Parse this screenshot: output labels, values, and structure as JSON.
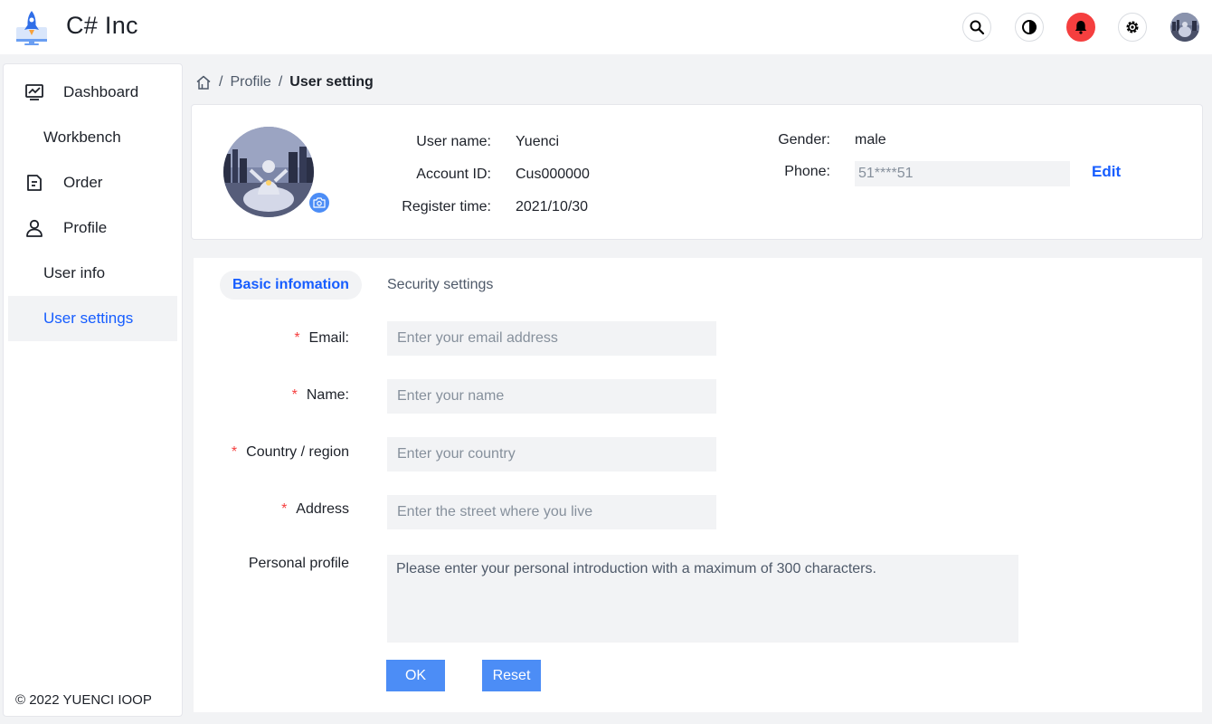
{
  "app": {
    "brand": "C# Inc"
  },
  "header": {
    "icons": [
      "search-icon",
      "theme-toggle-icon",
      "bell-icon",
      "gear-icon",
      "avatar"
    ],
    "bell_color": "#f53f3f"
  },
  "sidebar": {
    "items": [
      {
        "label": "Dashboard",
        "icon": "dashboard-icon"
      },
      {
        "label": "Workbench"
      },
      {
        "label": "Order",
        "icon": "order-icon"
      },
      {
        "label": "Profile",
        "icon": "user-icon"
      },
      {
        "label": "User info"
      },
      {
        "label": "User settings",
        "active": true
      }
    ],
    "copyright": "© 2022 YUENCI IOOP"
  },
  "breadcrumb": {
    "root": "Profile",
    "current": "User setting"
  },
  "profile": {
    "username_label": "User name:",
    "username": "Yuenci",
    "account_label": "Account ID:",
    "account_id": "Cus000000",
    "register_label": "Register time:",
    "register_time": "2021/10/30",
    "gender_label": "Gender:",
    "gender": "male",
    "phone_label": "Phone:",
    "phone": "51****51",
    "edit_label": "Edit"
  },
  "tabs": [
    {
      "label": "Basic infomation",
      "active": true
    },
    {
      "label": "Security settings",
      "active": false
    }
  ],
  "form": {
    "email": {
      "label": "Email:",
      "placeholder": "Enter your email address",
      "required": true
    },
    "name": {
      "label": "Name:",
      "placeholder": "Enter your name",
      "required": true
    },
    "country": {
      "label": "Country / region",
      "placeholder": "Enter your country",
      "required": true
    },
    "address": {
      "label": "Address",
      "placeholder": "Enter the street where you live",
      "required": true
    },
    "profile": {
      "label": "Personal profile",
      "placeholder": "Please enter your personal introduction with a maximum of 300 characters.",
      "required": false
    },
    "required_mark": "*",
    "ok_label": "OK",
    "reset_label": "Reset"
  },
  "colors": {
    "accent": "#165dff",
    "button": "#4c8df6",
    "required": "#f53f3f",
    "input_bg": "#f2f3f5"
  }
}
